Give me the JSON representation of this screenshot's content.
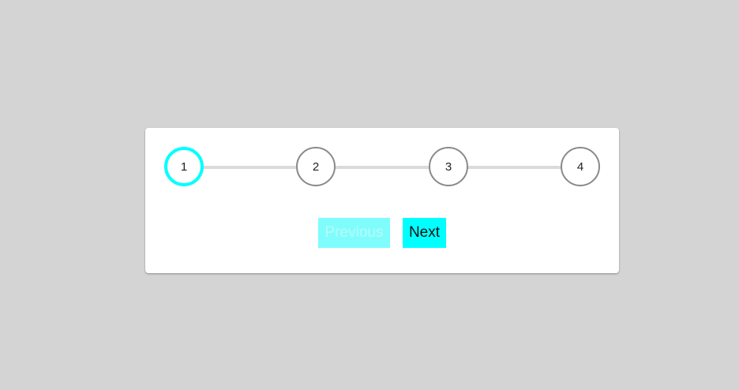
{
  "stepper": {
    "steps": [
      {
        "label": "1",
        "state": "active"
      },
      {
        "label": "2",
        "state": "inactive"
      },
      {
        "label": "3",
        "state": "inactive"
      },
      {
        "label": "4",
        "state": "inactive"
      }
    ],
    "current_step": 1,
    "total_steps": 4,
    "colors": {
      "accent": "#00ffff",
      "inactive_border": "#8a8a8a",
      "track": "#dadada",
      "background": "#d4d4d4"
    }
  },
  "controls": {
    "previous_label": "Previous",
    "previous_disabled": true,
    "next_label": "Next"
  }
}
